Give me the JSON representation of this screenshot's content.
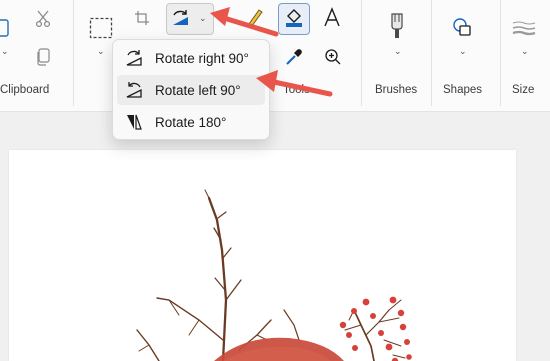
{
  "ribbon": {
    "groups": {
      "clipboard": "Clipboard",
      "tools": "Tools",
      "brushes": "Brushes",
      "shapes": "Shapes",
      "size": "Size"
    }
  },
  "rotate_menu": {
    "items": [
      {
        "label": "Rotate right 90°",
        "icon": "rotate-right-icon"
      },
      {
        "label": "Rotate left 90°",
        "icon": "rotate-left-icon"
      },
      {
        "label": "Rotate 180°",
        "icon": "rotate-180-icon"
      }
    ]
  },
  "colors": {
    "annotation_arrow": "#e8554a",
    "accent_blue": "#1565c0",
    "painting_red": "#c94a3a",
    "berry_red": "#d8413a",
    "branch_brown": "#6b3a22"
  }
}
